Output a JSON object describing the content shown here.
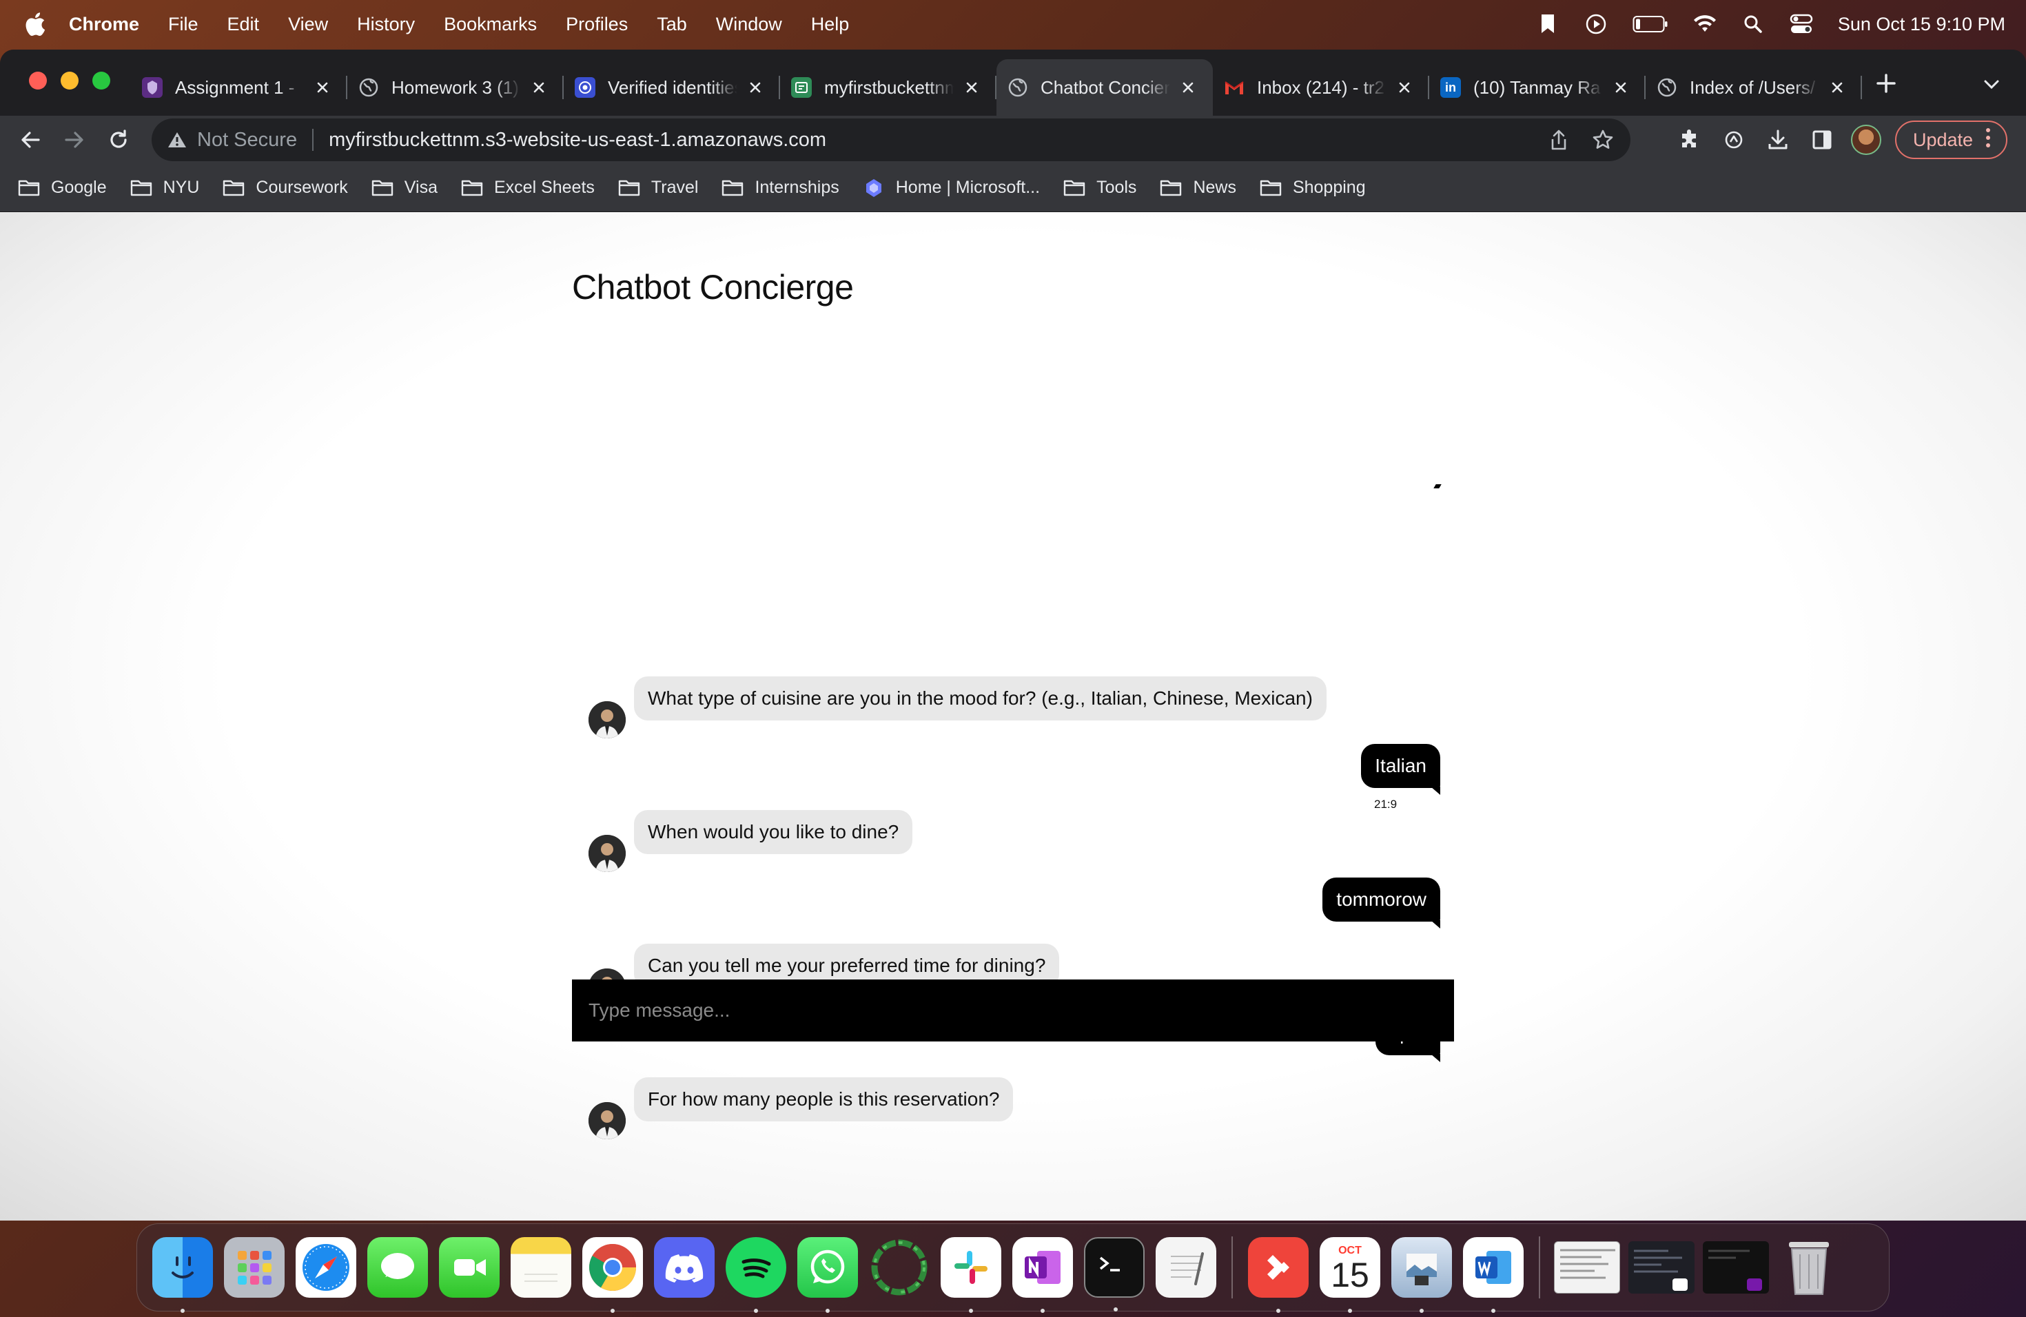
{
  "menubar": {
    "app_name": "Chrome",
    "items": [
      "File",
      "Edit",
      "View",
      "History",
      "Bookmarks",
      "Profiles",
      "Tab",
      "Window",
      "Help"
    ],
    "clock": "Sun Oct 15  9:10 PM"
  },
  "tabs": [
    {
      "title": "Assignment 1 -",
      "favicon": "assignment-icon",
      "color": "#5b2c83"
    },
    {
      "title": "Homework 3 (1)",
      "favicon": "globe-icon",
      "color": "#5f6368"
    },
    {
      "title": "Verified identities",
      "favicon": "verified-icon",
      "color": "#3a4fd1"
    },
    {
      "title": "myfirstbuckettnm",
      "favicon": "bucket-icon",
      "color": "#2e8b57"
    },
    {
      "title": "Chatbot Concierge",
      "favicon": "globe-icon",
      "color": "#5f6368",
      "active": true
    },
    {
      "title": "Inbox (214) - tr2",
      "favicon": "gmail-icon",
      "color": "#ea4335"
    },
    {
      "title": "(10) Tanmay Ra",
      "favicon": "linkedin-icon",
      "color": "#0a66c2"
    },
    {
      "title": "Index of /Users/",
      "favicon": "globe-icon",
      "color": "#5f6368"
    }
  ],
  "omnibox": {
    "security_label": "Not Secure",
    "url": "myfirstbuckettnm.s3-website-us-east-1.amazonaws.com"
  },
  "toolbar": {
    "update_label": "Update"
  },
  "bookmarks": [
    {
      "label": "Google",
      "icon": "folder-icon"
    },
    {
      "label": "NYU",
      "icon": "folder-icon"
    },
    {
      "label": "Coursework",
      "icon": "folder-icon"
    },
    {
      "label": "Visa",
      "icon": "folder-icon"
    },
    {
      "label": "Excel Sheets",
      "icon": "folder-icon"
    },
    {
      "label": "Travel",
      "icon": "folder-icon"
    },
    {
      "label": "Internships",
      "icon": "folder-icon"
    },
    {
      "label": "Home | Microsoft...",
      "icon": "microsoft-icon"
    },
    {
      "label": "Tools",
      "icon": "folder-icon"
    },
    {
      "label": "News",
      "icon": "folder-icon"
    },
    {
      "label": "Shopping",
      "icon": "folder-icon"
    }
  ],
  "page": {
    "title": "Chatbot Concierge",
    "messages": [
      {
        "sender": "bot",
        "text": "What type of cuisine are you in the mood for? (e.g., Italian, Chinese, Mexican)"
      },
      {
        "sender": "user",
        "text": "Italian",
        "timestamp": "21:9"
      },
      {
        "sender": "bot",
        "text": "When would you like to dine?"
      },
      {
        "sender": "user",
        "text": "tommorow"
      },
      {
        "sender": "bot",
        "text": "Can you tell me your preferred time for dining?"
      },
      {
        "sender": "user",
        "text": "5pm"
      },
      {
        "sender": "bot",
        "text": "For how many people is this reservation?"
      }
    ],
    "input_placeholder": "Type message..."
  },
  "dock": {
    "calendar_month": "OCT",
    "calendar_day": "15",
    "apps": [
      "finder",
      "launchpad",
      "safari",
      "messages",
      "facetime",
      "notes",
      "chrome",
      "discord",
      "spotify",
      "whatsapp",
      "circle-app",
      "slack",
      "onenote",
      "terminal",
      "textedit",
      "anydesk",
      "calendar",
      "preview",
      "word"
    ]
  }
}
